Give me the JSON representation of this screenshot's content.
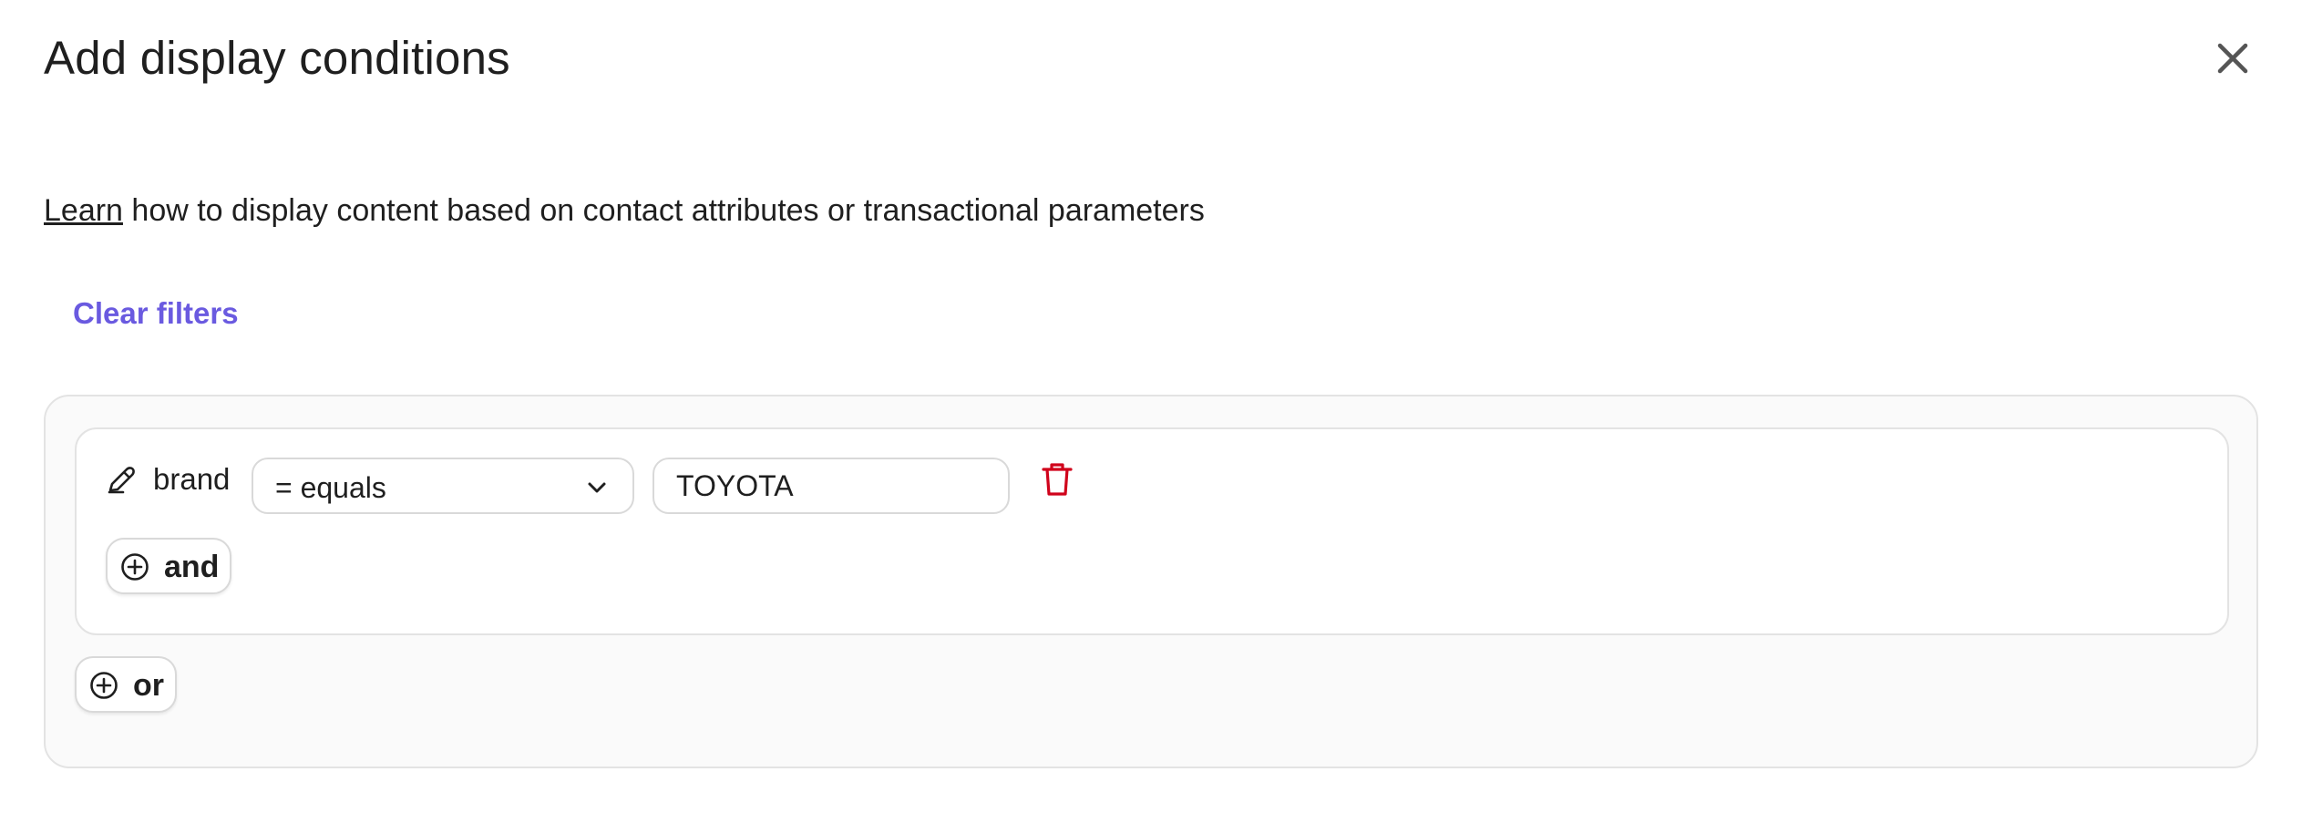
{
  "dialog": {
    "title": "Add display conditions",
    "close_icon": "close-icon"
  },
  "intro": {
    "link_text": "Learn",
    "text": " how to display content based on contact attributes or transactional parameters"
  },
  "clear_filters": "Clear filters",
  "condition_group": {
    "conditions": [
      {
        "field": "brand",
        "edit_icon": "pencil-icon",
        "operator": "= equals",
        "value": "TOYOTA",
        "delete_icon": "trash-icon"
      }
    ],
    "and_label": "and"
  },
  "or_label": "or",
  "colors": {
    "accent": "#6a5ae0",
    "danger": "#d0021b",
    "border": "#e3e3e3",
    "panel_bg": "#fafafa"
  }
}
